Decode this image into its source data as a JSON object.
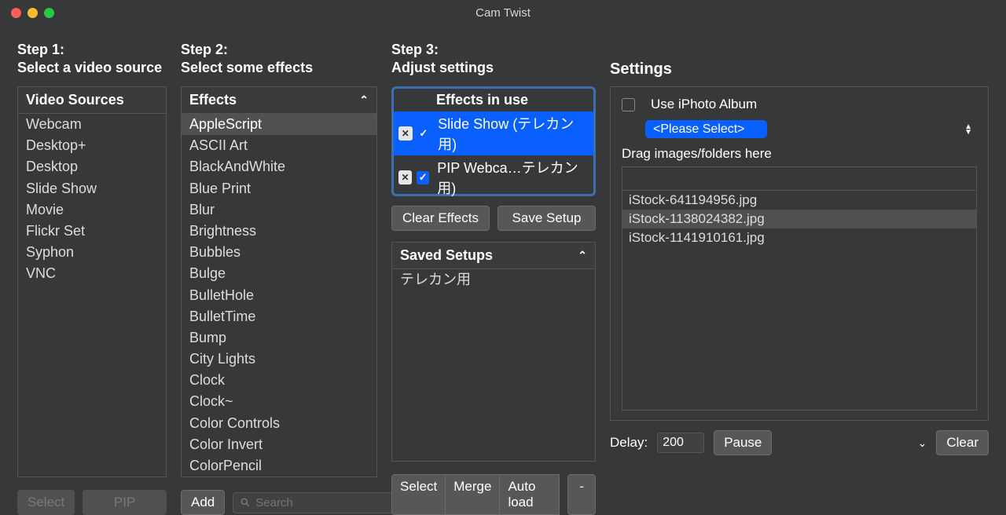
{
  "title": "Cam Twist",
  "steps": {
    "s1": "Step 1:\nSelect a video source",
    "s2": "Step 2:\nSelect some effects",
    "s3": "Step 3:\nAdjust settings",
    "settings": "Settings"
  },
  "col1": {
    "header": "Video Sources",
    "items": [
      "Webcam",
      "Desktop+",
      "Desktop",
      "Slide Show",
      "Movie",
      "Flickr Set",
      "Syphon",
      "VNC"
    ],
    "select_btn": "Select",
    "pip_btn": "PIP"
  },
  "col2": {
    "header": "Effects",
    "items": [
      "AppleScript",
      "ASCII Art",
      "BlackAndWhite",
      "Blue Print",
      "Blur",
      "Brightness",
      "Bubbles",
      "Bulge",
      "BulletHole",
      "BulletTime",
      "Bump",
      "City Lights",
      "Clock",
      "Clock~",
      "Color Controls",
      "Color Invert",
      "ColorPencil"
    ],
    "selected_index": 0,
    "add_btn": "Add",
    "search_ph": "Search"
  },
  "col3": {
    "header": "Effects in use",
    "rows": [
      {
        "label": "Slide Show (テレカン用)",
        "checked": true,
        "highlight": true
      },
      {
        "label": "PIP Webca…テレカン用)",
        "checked": true,
        "highlight": false
      }
    ],
    "clear_btn": "Clear Effects",
    "save_btn": "Save Setup",
    "saved_header": "Saved Setups",
    "saved_items": [
      "テレカン用"
    ],
    "seg": {
      "select": "Select",
      "merge": "Merge",
      "auto": "Auto load",
      "minus": "-"
    }
  },
  "col4": {
    "use_iphoto": "Use iPhoto Album",
    "please_select": "<Please Select>",
    "drag_label": "Drag images/folders here",
    "files": [
      "iStock-641194956.jpg",
      "iStock-1138024382.jpg",
      "iStock-1141910161.jpg"
    ],
    "file_selected_index": 1,
    "delay_label": "Delay:",
    "delay_value": "200",
    "pause_btn": "Pause",
    "clear_btn": "Clear"
  }
}
